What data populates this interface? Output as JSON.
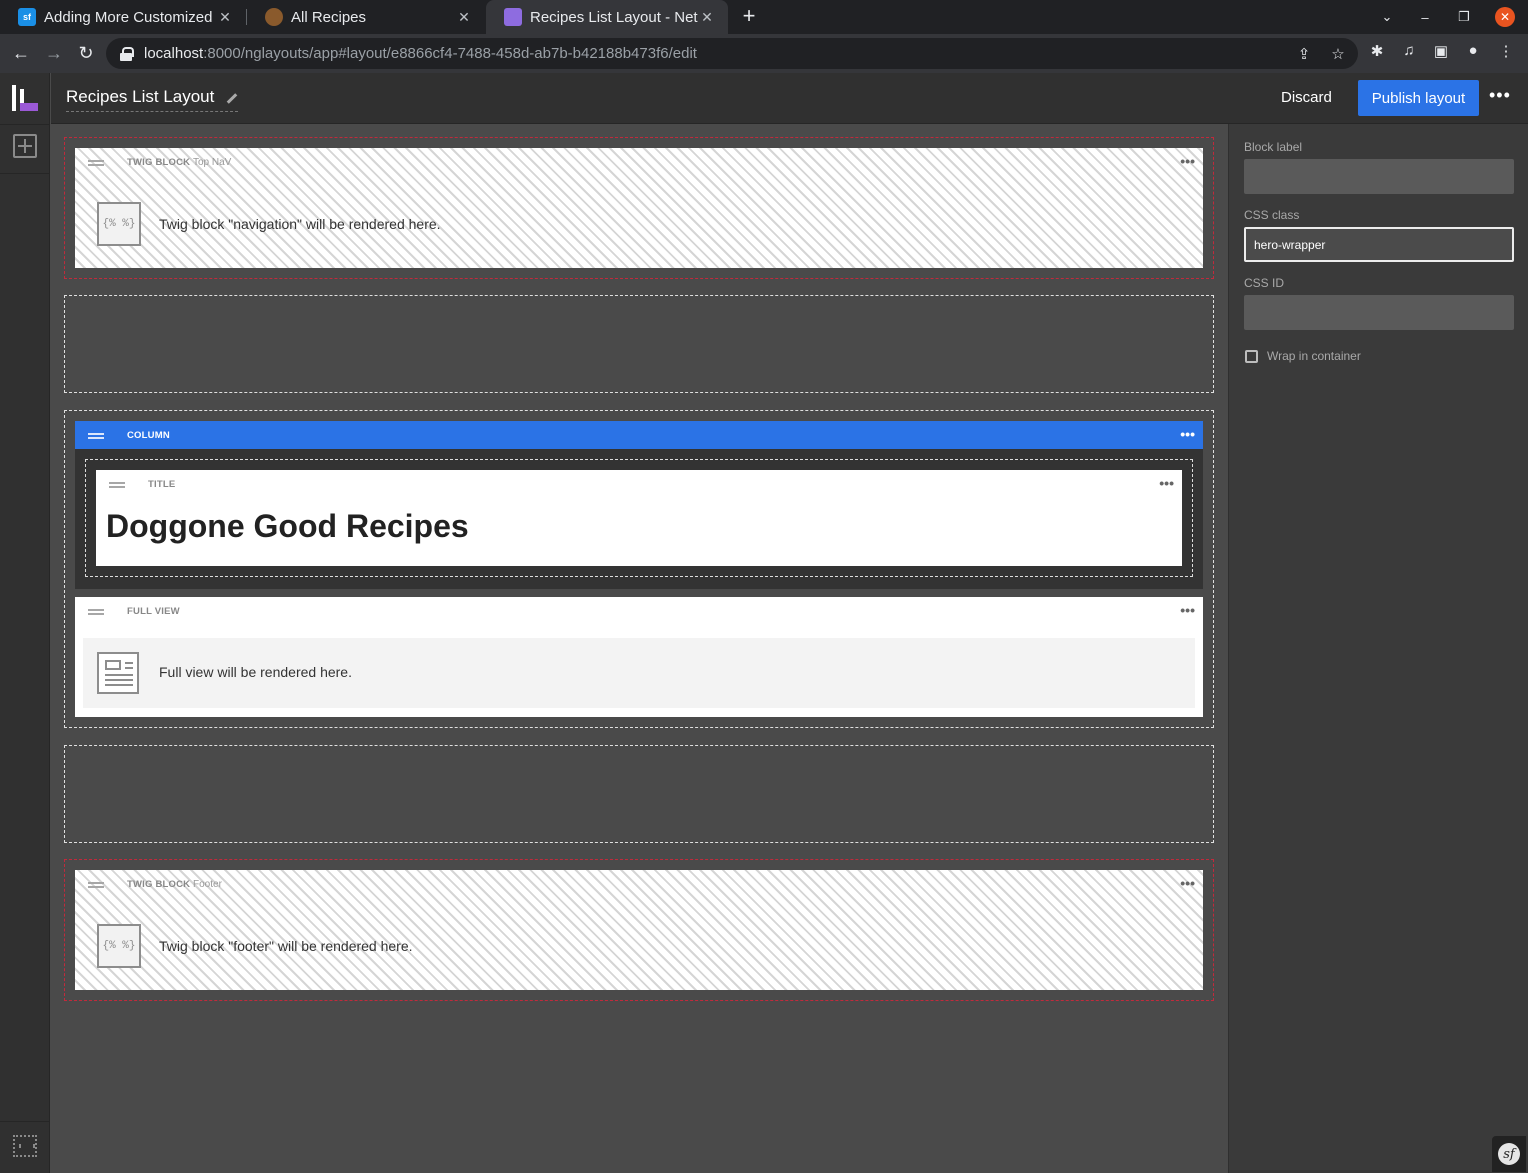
{
  "browser": {
    "tabs": [
      {
        "title": "Adding More Customized",
        "favicon_text": "sf",
        "favicon_color": "#1a8fe6"
      },
      {
        "title": "All Recipes",
        "favicon_text": "",
        "favicon_color": "#8a5a2c"
      },
      {
        "title": "Recipes List Layout - Netg",
        "favicon_text": "",
        "favicon_color": "#8e6ce0"
      }
    ],
    "url_host": "localhost",
    "url_rest": ":8000/nglayouts/app#layout/e8866cf4-7488-458d-ab7b-b42188b473f6/edit"
  },
  "header": {
    "layout_name": "Recipes List Layout",
    "discard_label": "Discard",
    "publish_label": "Publish layout"
  },
  "canvas": {
    "top_block": {
      "type": "TWIG BLOCK",
      "name": "Top NaV",
      "icon_text": "{% %}",
      "text": "Twig block \"navigation\" will be rendered here."
    },
    "column_block": {
      "type": "COLUMN"
    },
    "title_block": {
      "type": "TITLE",
      "text": "Doggone Good Recipes"
    },
    "full_view_block": {
      "type": "FULL VIEW",
      "text": "Full view will be rendered here."
    },
    "footer_block": {
      "type": "TWIG BLOCK",
      "name": "Footer",
      "icon_text": "{% %}",
      "text": "Twig block \"footer\" will be rendered here."
    }
  },
  "sidebar": {
    "block_label": {
      "label": "Block label",
      "value": ""
    },
    "css_class": {
      "label": "CSS class",
      "value": "hero-wrapper"
    },
    "css_id": {
      "label": "CSS ID",
      "value": ""
    },
    "wrap_label": "Wrap in container"
  },
  "colors": {
    "accent": "#2b73e6",
    "linked_zone": "#c12a3c",
    "logo_accent": "#9b59d6"
  }
}
